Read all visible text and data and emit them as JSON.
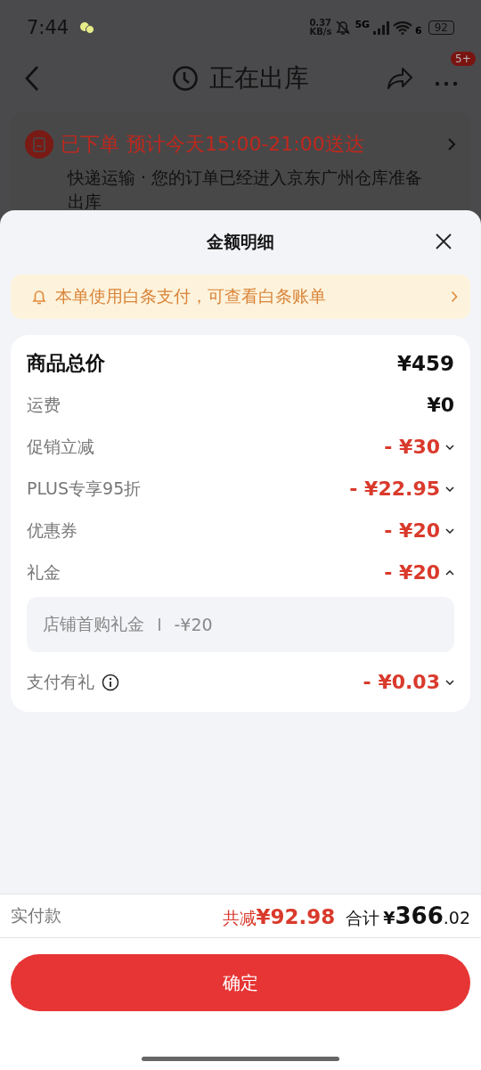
{
  "status_bar": {
    "time": "7:44",
    "speed_value": "0.37",
    "speed_unit": "KB/s",
    "network": "5G",
    "wifi_band": "6",
    "battery": "92"
  },
  "header": {
    "title": "正在出库",
    "badge": "5+"
  },
  "order_card": {
    "status": "已下单",
    "eta": "预计今天15:00-21:00送达",
    "detail": "快递运输 · 您的订单已经进入京东广州仓库准备出库"
  },
  "sheet": {
    "title": "金额明细",
    "notice": "本单使用白条支付，可查看白条账单",
    "rows": [
      {
        "kind": "total",
        "label": "商品总价",
        "amount": "¥459"
      },
      {
        "kind": "plain",
        "label": "运费",
        "amount": "¥0"
      },
      {
        "kind": "discount",
        "label": "促销立减",
        "amount": "- ¥30",
        "expanded": false
      },
      {
        "kind": "discount",
        "label": "PLUS专享95折",
        "amount": "- ¥22.95",
        "expanded": false
      },
      {
        "kind": "discount",
        "label": "优惠券",
        "amount": "- ¥20",
        "expanded": false
      },
      {
        "kind": "discount",
        "label": "礼金",
        "amount": "- ¥20",
        "expanded": true,
        "details": [
          {
            "label": "店铺首购礼金",
            "amount": "-¥20"
          }
        ]
      },
      {
        "kind": "discount",
        "label": "支付有礼",
        "amount": "- ¥0.03",
        "expanded": false,
        "info": true
      }
    ],
    "footer": {
      "label": "实付款",
      "saved_label": "共减",
      "saved": "¥92.98",
      "total_label": "合计",
      "total_currency": "¥",
      "total_int": "366",
      "total_dec": ".02"
    },
    "confirm_button": "确定"
  }
}
